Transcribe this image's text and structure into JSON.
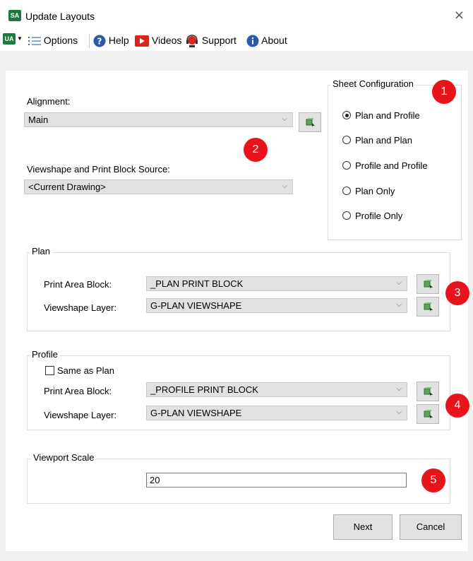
{
  "window": {
    "app_badge": "SA",
    "title": "Update Layouts",
    "close_glyph": "×"
  },
  "toolbar": {
    "ua_badge": "UA",
    "options": "Options",
    "help": "Help",
    "videos": "Videos",
    "support": "Support",
    "about": "About"
  },
  "alignment": {
    "label": "Alignment:",
    "value": "Main"
  },
  "source": {
    "label": "Viewshape and Print Block Source:",
    "value": "<Current Drawing>"
  },
  "sheet_config": {
    "title": "Sheet Configuration",
    "options": [
      "Plan and Profile",
      "Plan and Plan",
      "Profile and Profile",
      "Plan Only",
      "Profile Only"
    ],
    "selected": "Plan and Profile"
  },
  "plan": {
    "title": "Plan",
    "print_area_label": "Print Area Block:",
    "print_area_value": "_PLAN PRINT BLOCK",
    "viewshape_label": "Viewshape Layer:",
    "viewshape_value": "G-PLAN VIEWSHAPE"
  },
  "profile": {
    "title": "Profile",
    "same_as_plan": "Same as Plan",
    "print_area_label": "Print Area Block:",
    "print_area_value": "_PROFILE PRINT BLOCK",
    "viewshape_label": "Viewshape Layer:",
    "viewshape_value": "G-PLAN VIEWSHAPE"
  },
  "viewport": {
    "title": "Viewport Scale",
    "value": "20"
  },
  "badges": [
    "1",
    "2",
    "3",
    "4",
    "5"
  ],
  "buttons": {
    "next": "Next",
    "cancel": "Cancel"
  },
  "colors": {
    "badge": "#e8141b",
    "brand_green": "#1e7a3c"
  }
}
